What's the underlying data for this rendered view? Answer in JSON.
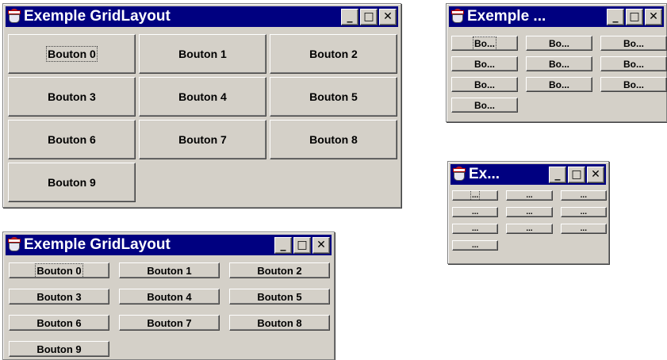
{
  "windows": {
    "large": {
      "title": "Exemple GridLayout",
      "controls": {
        "minimize": "_",
        "maximize": "□",
        "close": "✕"
      },
      "buttons": [
        "Bouton 0",
        "Bouton 1",
        "Bouton 2",
        "Bouton 3",
        "Bouton 4",
        "Bouton 5",
        "Bouton 6",
        "Bouton 7",
        "Bouton 8",
        "Bouton 9"
      ]
    },
    "medium": {
      "title": "Exemple GridLayout",
      "controls": {
        "minimize": "_",
        "maximize": "□",
        "close": "✕"
      },
      "buttons": [
        "Bouton 0",
        "Bouton 1",
        "Bouton 2",
        "Bouton 3",
        "Bouton 4",
        "Bouton 5",
        "Bouton 6",
        "Bouton 7",
        "Bouton 8",
        "Bouton 9"
      ]
    },
    "small": {
      "title": "Exemple ...",
      "controls": {
        "minimize": "_",
        "maximize": "□",
        "close": "✕"
      },
      "buttons": [
        "Bo...",
        "Bo...",
        "Bo...",
        "Bo...",
        "Bo...",
        "Bo...",
        "Bo...",
        "Bo...",
        "Bo...",
        "Bo..."
      ]
    },
    "tiny": {
      "title": "Ex...",
      "controls": {
        "minimize": "_",
        "maximize": "□",
        "close": "✕"
      },
      "buttons": [
        "...",
        "...",
        "...",
        "...",
        "...",
        "...",
        "...",
        "...",
        "...",
        "..."
      ]
    }
  },
  "colors": {
    "title_bar": "#000080",
    "title_text": "#ffffff",
    "face": "#d4d0c8",
    "shadow": "#808080",
    "dark_shadow": "#404040",
    "highlight": "#ffffff"
  },
  "icons": {
    "app": "java-cup-icon"
  }
}
